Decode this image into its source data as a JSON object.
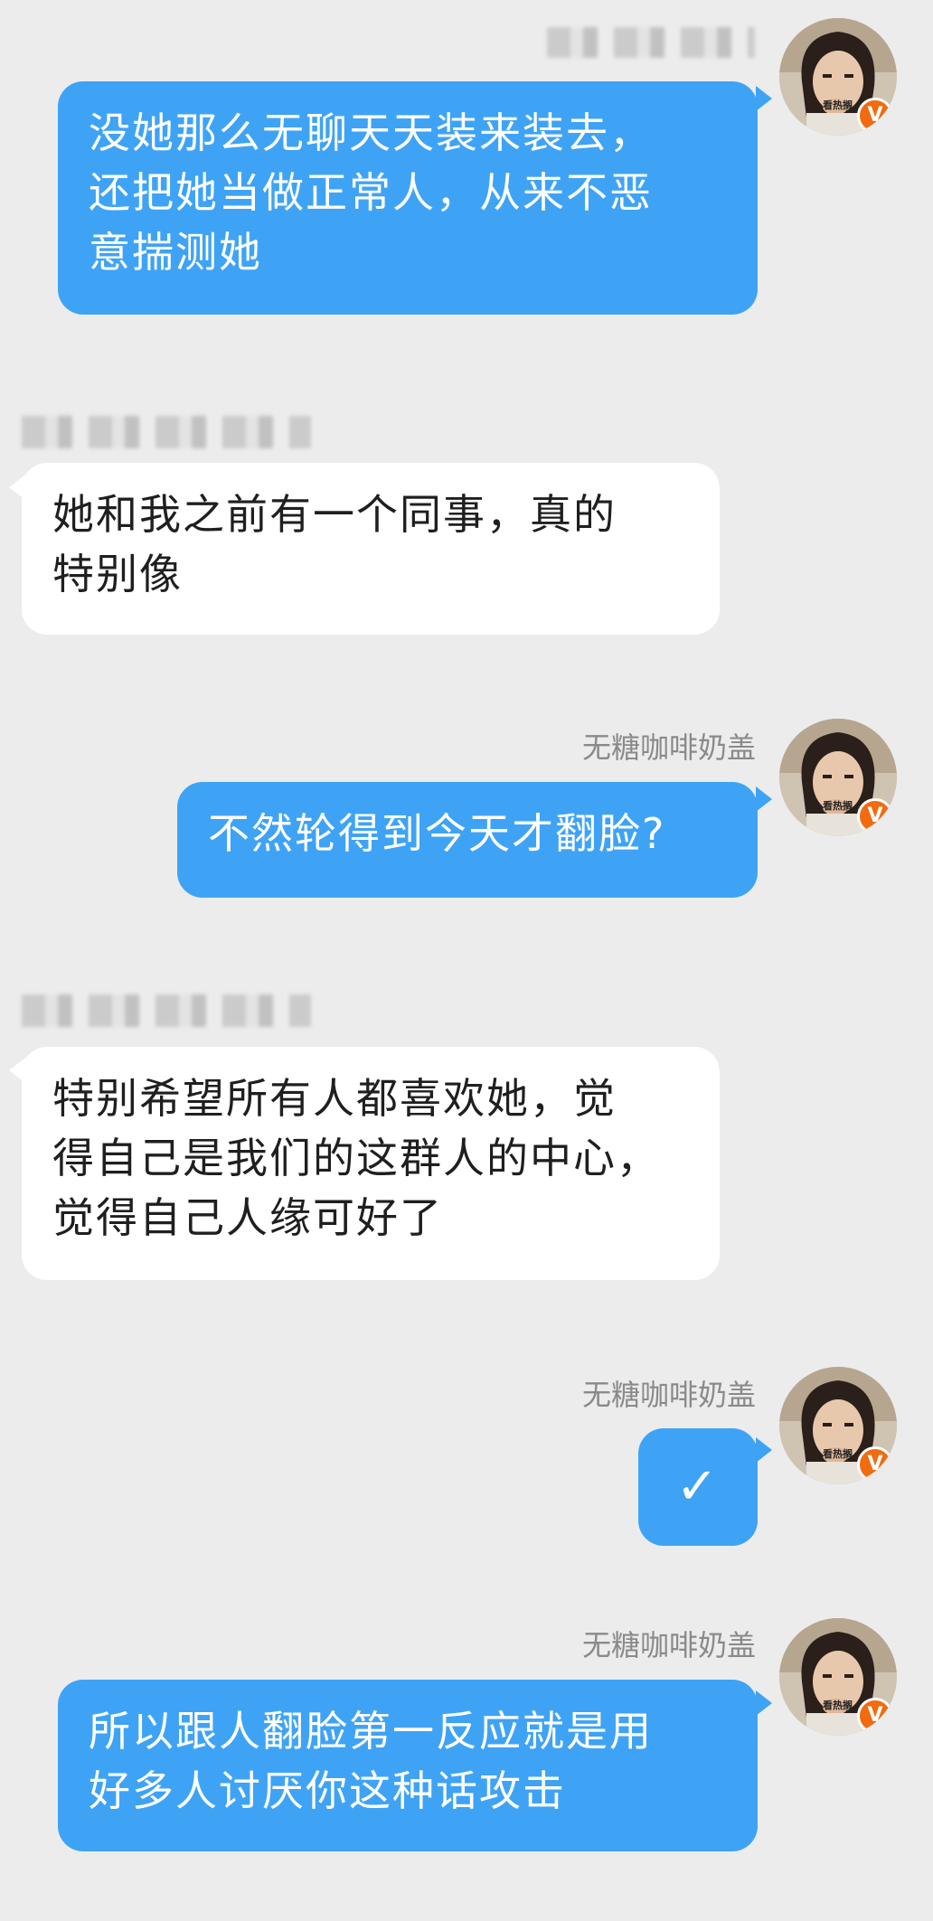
{
  "colors": {
    "background": "#ececed",
    "my_bubble": "#3fa3f5",
    "their_bubble": "#ffffff",
    "name_text": "#8a8a8a",
    "badge": "#f26b0f"
  },
  "avatar": {
    "caption": "看热搁",
    "badge_icon": "v-verified-icon"
  },
  "messages": [
    {
      "side": "me",
      "sender": "",
      "lines": [
        "没她那么无聊天天装来装去，",
        "还把她当做正常人，从来不恶",
        "意揣测她"
      ]
    },
    {
      "side": "them",
      "sender": "",
      "lines": [
        "她和我之前有一个同事，真的",
        "特别像"
      ]
    },
    {
      "side": "me",
      "sender": "无糖咖啡奶盖",
      "lines": [
        "不然轮得到今天才翻脸?"
      ]
    },
    {
      "side": "them",
      "sender": "",
      "lines": [
        "特别希望所有人都喜欢她，觉",
        "得自己是我们的这群人的中心，",
        "觉得自己人缘可好了"
      ]
    },
    {
      "side": "me",
      "sender": "无糖咖啡奶盖",
      "lines": [
        "✓"
      ]
    },
    {
      "side": "me",
      "sender": "无糖咖啡奶盖",
      "lines": [
        "所以跟人翻脸第一反应就是用",
        "好多人讨厌你这种话攻击"
      ]
    }
  ]
}
